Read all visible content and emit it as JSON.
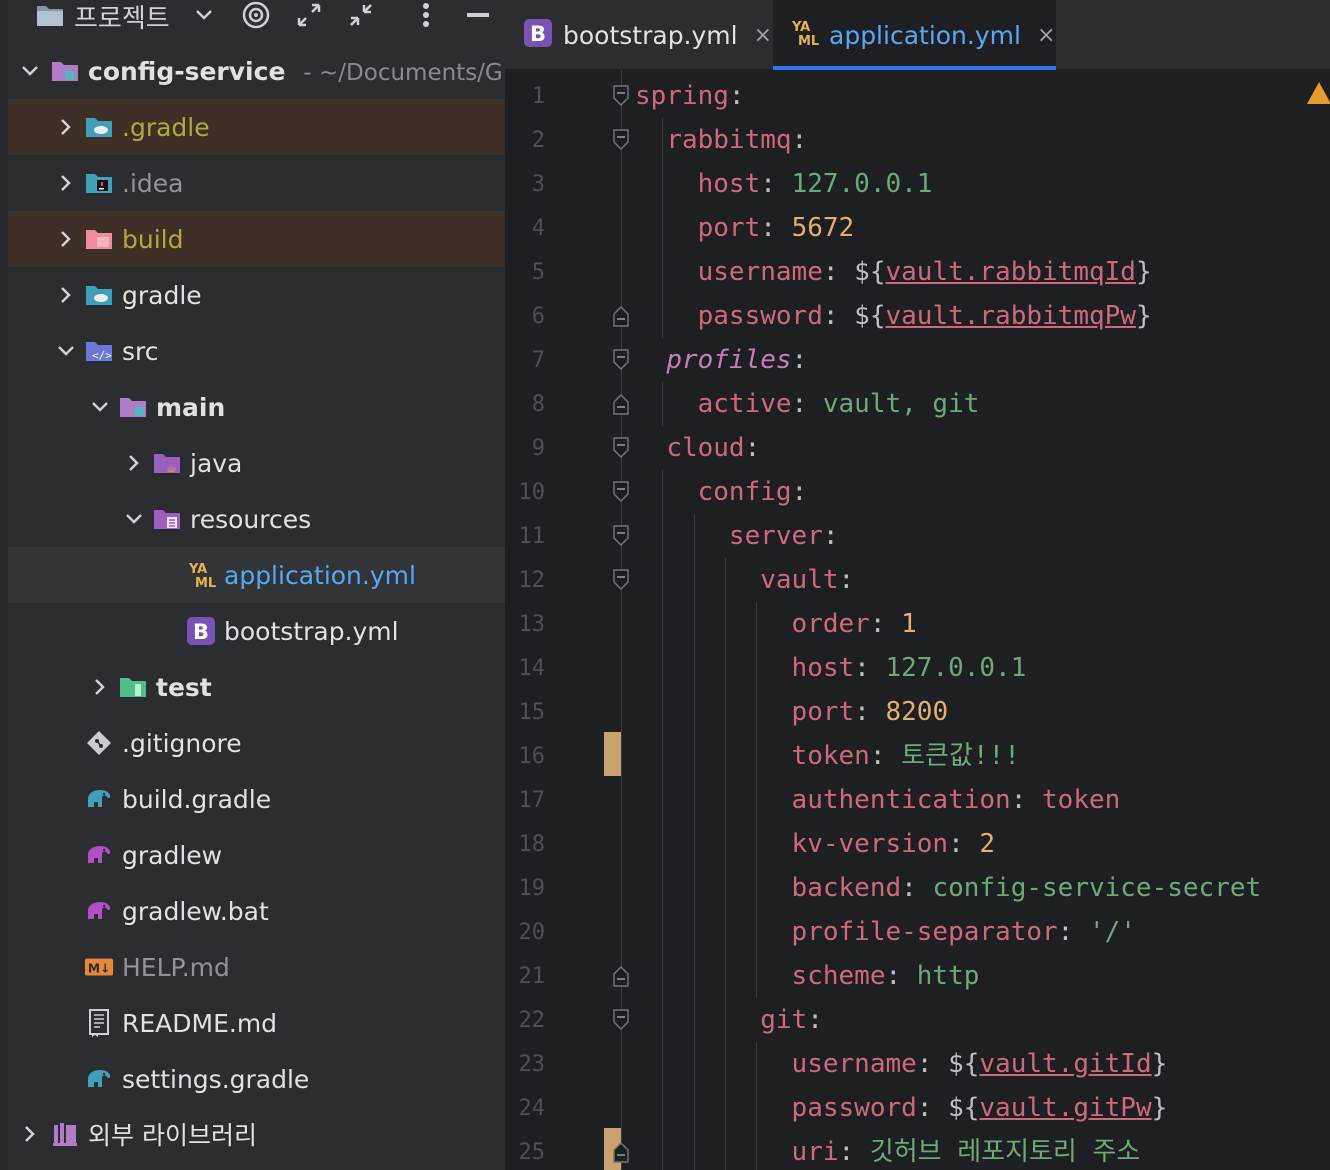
{
  "panel": {
    "title": "프로젝트",
    "root": {
      "name": "config-service",
      "path": "- ~/Documents/G"
    },
    "items": [
      {
        "label": ".gradle",
        "icon": "gradle-folder-icon"
      },
      {
        "label": ".idea",
        "icon": "idea-folder-icon"
      },
      {
        "label": "build",
        "icon": "build-folder-icon"
      },
      {
        "label": "gradle",
        "icon": "gradle-folder-icon"
      },
      {
        "label": "src",
        "icon": "source-folder-icon"
      },
      {
        "label": "main",
        "icon": "module-folder-icon"
      },
      {
        "label": "java",
        "icon": "java-folder-icon"
      },
      {
        "label": "resources",
        "icon": "resources-folder-icon"
      },
      {
        "label": "application.yml",
        "icon": "yaml-file-icon"
      },
      {
        "label": "bootstrap.yml",
        "icon": "bootstrap-file-icon"
      },
      {
        "label": "test",
        "icon": "test-folder-icon"
      },
      {
        "label": ".gitignore",
        "icon": "gitignore-file-icon"
      },
      {
        "label": "build.gradle",
        "icon": "gradle-elephant-icon"
      },
      {
        "label": "gradlew",
        "icon": "gradle-elephant-purple-icon"
      },
      {
        "label": "gradlew.bat",
        "icon": "gradle-elephant-purple-icon"
      },
      {
        "label": "HELP.md",
        "icon": "markdown-file-icon"
      },
      {
        "label": "README.md",
        "icon": "readme-file-icon"
      },
      {
        "label": "settings.gradle",
        "icon": "gradle-elephant-icon"
      }
    ],
    "external_libs": "외부 라이브러리"
  },
  "tabs": [
    {
      "label": "bootstrap.yml",
      "close": "×",
      "active": false
    },
    {
      "label": "application.yml",
      "close": "×",
      "active": true
    }
  ],
  "code_lines": [
    [
      [
        "k",
        "spring"
      ],
      [
        "p",
        ":"
      ]
    ],
    [
      [
        "p",
        "  "
      ],
      [
        "k",
        "rabbitmq"
      ],
      [
        "p",
        ":"
      ]
    ],
    [
      [
        "p",
        "    "
      ],
      [
        "k",
        "host"
      ],
      [
        "p",
        ": "
      ],
      [
        "s",
        "127.0.0.1"
      ]
    ],
    [
      [
        "p",
        "    "
      ],
      [
        "k",
        "port"
      ],
      [
        "p",
        ": "
      ],
      [
        "num",
        "5672"
      ]
    ],
    [
      [
        "p",
        "    "
      ],
      [
        "k",
        "username"
      ],
      [
        "p",
        ": ${"
      ],
      [
        "vref",
        "vault.rabbitmqId"
      ],
      [
        "p",
        "}"
      ]
    ],
    [
      [
        "p",
        "    "
      ],
      [
        "k",
        "password"
      ],
      [
        "p",
        ": ${"
      ],
      [
        "vref",
        "vault.rabbitmqPw"
      ],
      [
        "p",
        "}"
      ]
    ],
    [
      [
        "p",
        "  "
      ],
      [
        "ki",
        "profiles"
      ],
      [
        "p",
        ":"
      ]
    ],
    [
      [
        "p",
        "    "
      ],
      [
        "k",
        "active"
      ],
      [
        "p",
        ": "
      ],
      [
        "s",
        "vault, git"
      ]
    ],
    [
      [
        "p",
        "  "
      ],
      [
        "k",
        "cloud"
      ],
      [
        "p",
        ":"
      ]
    ],
    [
      [
        "p",
        "    "
      ],
      [
        "k",
        "config"
      ],
      [
        "p",
        ":"
      ]
    ],
    [
      [
        "p",
        "      "
      ],
      [
        "k",
        "server"
      ],
      [
        "p",
        ":"
      ]
    ],
    [
      [
        "p",
        "        "
      ],
      [
        "k",
        "vault"
      ],
      [
        "p",
        ":"
      ]
    ],
    [
      [
        "p",
        "          "
      ],
      [
        "k",
        "order"
      ],
      [
        "p",
        ": "
      ],
      [
        "num",
        "1"
      ]
    ],
    [
      [
        "p",
        "          "
      ],
      [
        "k",
        "host"
      ],
      [
        "p",
        ": "
      ],
      [
        "s",
        "127.0.0.1"
      ]
    ],
    [
      [
        "p",
        "          "
      ],
      [
        "k",
        "port"
      ],
      [
        "p",
        ": "
      ],
      [
        "num",
        "8200"
      ]
    ],
    [
      [
        "p",
        "          "
      ],
      [
        "k",
        "token"
      ],
      [
        "p",
        ": "
      ],
      [
        "s",
        "토큰값!!!"
      ]
    ],
    [
      [
        "p",
        "          "
      ],
      [
        "k",
        "authentication"
      ],
      [
        "p",
        ": "
      ],
      [
        "k",
        "token"
      ]
    ],
    [
      [
        "p",
        "          "
      ],
      [
        "k",
        "kv-version"
      ],
      [
        "p",
        ": "
      ],
      [
        "num",
        "2"
      ]
    ],
    [
      [
        "p",
        "          "
      ],
      [
        "k",
        "backend"
      ],
      [
        "p",
        ": "
      ],
      [
        "s",
        "config-service-secret"
      ]
    ],
    [
      [
        "p",
        "          "
      ],
      [
        "k",
        "profile-separator"
      ],
      [
        "p",
        ": "
      ],
      [
        "s",
        "'/'"
      ]
    ],
    [
      [
        "p",
        "          "
      ],
      [
        "k",
        "scheme"
      ],
      [
        "p",
        ": "
      ],
      [
        "s",
        "http"
      ]
    ],
    [
      [
        "p",
        "        "
      ],
      [
        "k",
        "git"
      ],
      [
        "p",
        ":"
      ]
    ],
    [
      [
        "p",
        "          "
      ],
      [
        "k",
        "username"
      ],
      [
        "p",
        ": ${"
      ],
      [
        "vref",
        "vault.gitId"
      ],
      [
        "p",
        "}"
      ]
    ],
    [
      [
        "p",
        "          "
      ],
      [
        "k",
        "password"
      ],
      [
        "p",
        ": ${"
      ],
      [
        "vref",
        "vault.gitPw"
      ],
      [
        "p",
        "}"
      ]
    ],
    [
      [
        "p",
        "          "
      ],
      [
        "k",
        "uri"
      ],
      [
        "p",
        ": "
      ],
      [
        "s",
        "깃허브 레포지토리 주소"
      ]
    ]
  ],
  "line_numbers": [
    "1",
    "2",
    "3",
    "4",
    "5",
    "6",
    "7",
    "8",
    "9",
    "10",
    "11",
    "12",
    "13",
    "14",
    "15",
    "16",
    "17",
    "18",
    "19",
    "20",
    "21",
    "22",
    "23",
    "24",
    "25"
  ],
  "colors": {
    "accent": "#3574f0",
    "key": "#cf6977",
    "string": "#6aab73",
    "number": "#e7ad6c",
    "gradle_label": "#b9a53d",
    "yaml_label": "#56a8f5"
  }
}
